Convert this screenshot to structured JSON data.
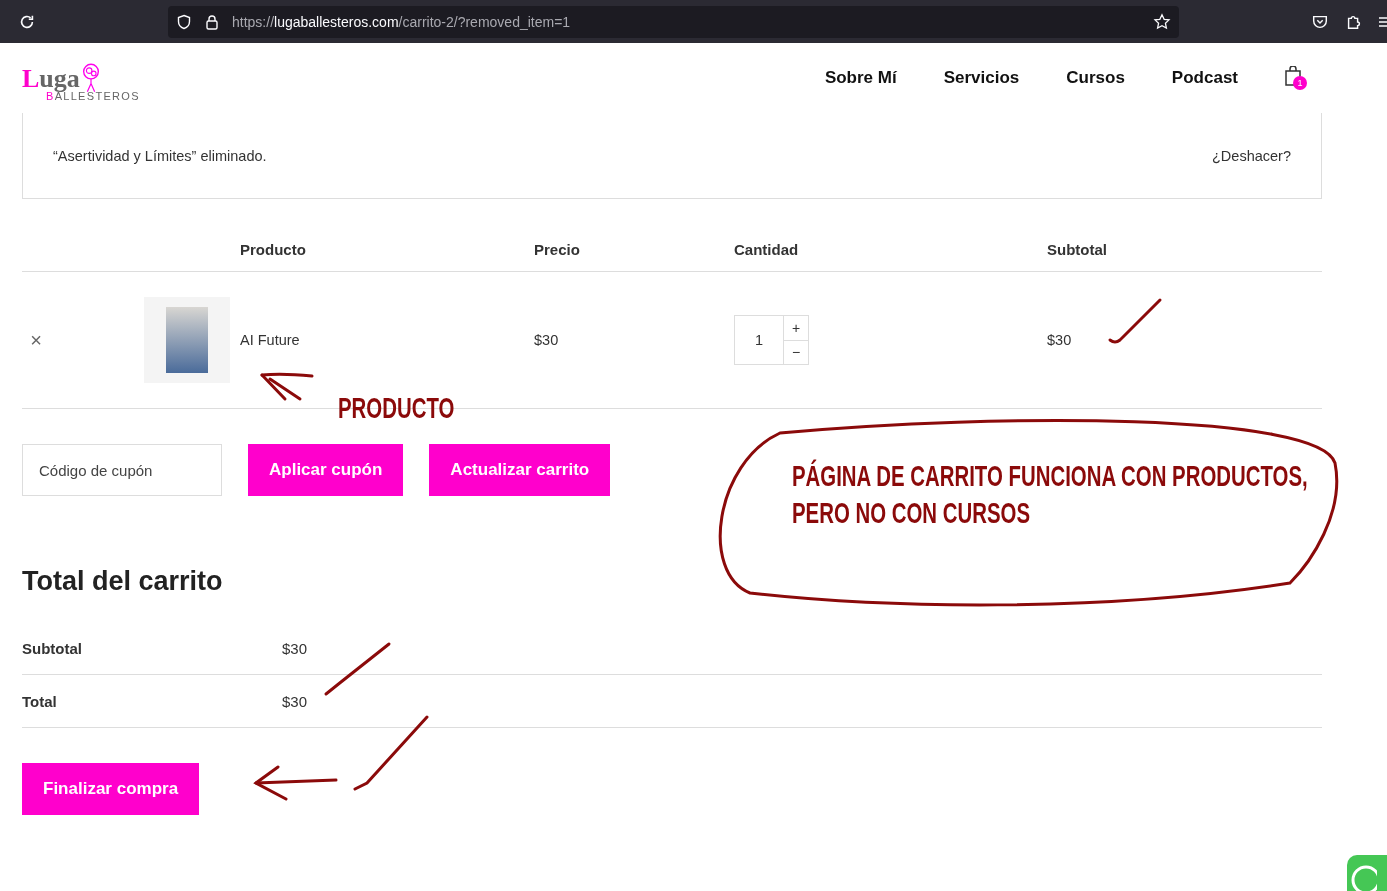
{
  "browser": {
    "url_host": "lugaballesteros.com",
    "url_scheme": "https://",
    "url_path": "/carrito-2/?removed_item=1"
  },
  "header": {
    "logo_main": "Luga",
    "logo_sub_initial": "B",
    "logo_sub": "ALLESTEROS",
    "nav": [
      "Sobre Mí",
      "Servicios",
      "Cursos",
      "Podcast"
    ],
    "cart_count": "1"
  },
  "notice": {
    "message": "“Asertividad y Límites” eliminado.",
    "undo": "¿Deshacer?"
  },
  "cart_table": {
    "columns": [
      "Producto",
      "Precio",
      "Cantidad",
      "Subtotal"
    ],
    "rows": [
      {
        "remove": "×",
        "product": "AI Future",
        "price": "$30",
        "quantity": "1",
        "plus": "+",
        "minus": "−",
        "subtotal": "$30"
      }
    ]
  },
  "coupon": {
    "placeholder": "Código de cupón",
    "apply": "Aplicar cupón",
    "update": "Actualizar carrito"
  },
  "totals": {
    "title": "Total del carrito",
    "rows": [
      {
        "label": "Subtotal",
        "value": "$30"
      },
      {
        "label": "Total",
        "value": "$30"
      }
    ],
    "checkout": "Finalizar compra"
  },
  "annotations": {
    "product_label": "PRODUCTO",
    "note_lines": [
      "PÁGINA DE CARRITO FUNCIONA CON PRODUCTOS,",
      "PERO NO CON CURSOS"
    ]
  }
}
